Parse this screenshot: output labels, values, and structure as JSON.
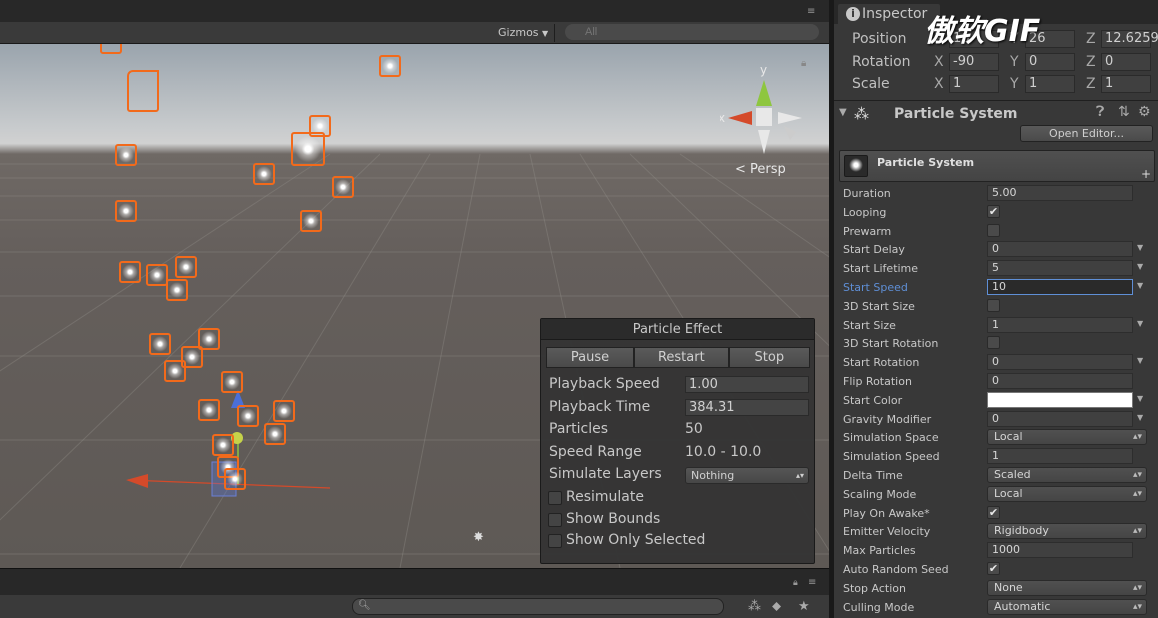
{
  "scene": {
    "gizmos_label": "Gizmos",
    "search_placeholder": "All",
    "persp_label": "< Persp",
    "gizmo_axes": {
      "y": "y",
      "x": "x"
    }
  },
  "particle_effect": {
    "title": "Particle Effect",
    "buttons": [
      "Pause",
      "Restart",
      "Stop"
    ],
    "rows": [
      {
        "label": "Playback Speed",
        "value": "1.00"
      },
      {
        "label": "Playback Time",
        "value": "384.31"
      },
      {
        "label": "Particles",
        "value": "50"
      },
      {
        "label": "Speed Range",
        "value": "10.0 - 10.0"
      },
      {
        "label": "Simulate Layers",
        "value": "Nothing"
      }
    ],
    "checks": [
      "Resimulate",
      "Show Bounds",
      "Show Only Selected"
    ]
  },
  "inspector": {
    "tab_label": "Inspector",
    "watermark": "傲软GIF",
    "transform": [
      {
        "label": "Position",
        "x": "16",
        "y": "26",
        "z": "12.6259"
      },
      {
        "label": "Rotation",
        "x": "-90",
        "y": "0",
        "z": "0"
      },
      {
        "label": "Scale",
        "x": "1",
        "y": "1",
        "z": "1"
      }
    ],
    "axis_labels": [
      "X",
      "Y",
      "Z"
    ],
    "component_title": "Particle System",
    "open_editor": "Open Editor...",
    "module_title": "Particle System",
    "module_plus": "+",
    "properties": [
      {
        "label": "Duration",
        "kind": "field",
        "value": "5.00"
      },
      {
        "label": "Looping",
        "kind": "check",
        "value": "✔"
      },
      {
        "label": "Prewarm",
        "kind": "check",
        "value": ""
      },
      {
        "label": "Start Delay",
        "kind": "field",
        "value": "0",
        "tri": true
      },
      {
        "label": "Start Lifetime",
        "kind": "field",
        "value": "5",
        "tri": true
      },
      {
        "label": "Start Speed",
        "kind": "field",
        "value": "10",
        "tri": true,
        "focus": true
      },
      {
        "label": "3D Start Size",
        "kind": "check",
        "value": ""
      },
      {
        "label": "Start Size",
        "kind": "field",
        "value": "1",
        "tri": true
      },
      {
        "label": "3D Start Rotation",
        "kind": "check",
        "value": ""
      },
      {
        "label": "Start Rotation",
        "kind": "field",
        "value": "0",
        "tri": true
      },
      {
        "label": "Flip Rotation",
        "kind": "field",
        "value": "0"
      },
      {
        "label": "Start Color",
        "kind": "color",
        "value": "",
        "tri": true
      },
      {
        "label": "Gravity Modifier",
        "kind": "field",
        "value": "0",
        "tri": true
      },
      {
        "label": "Simulation Space",
        "kind": "drop",
        "value": "Local"
      },
      {
        "label": "Simulation Speed",
        "kind": "field",
        "value": "1"
      },
      {
        "label": "Delta Time",
        "kind": "drop",
        "value": "Scaled"
      },
      {
        "label": "Scaling Mode",
        "kind": "drop",
        "value": "Local"
      },
      {
        "label": "Play On Awake*",
        "kind": "check",
        "value": "✔"
      },
      {
        "label": "Emitter Velocity",
        "kind": "drop",
        "value": "Rigidbody"
      },
      {
        "label": "Max Particles",
        "kind": "field",
        "value": "1000"
      },
      {
        "label": "Auto Random Seed",
        "kind": "check",
        "value": "✔"
      },
      {
        "label": "Stop Action",
        "kind": "drop",
        "value": "None"
      },
      {
        "label": "Culling Mode",
        "kind": "drop",
        "value": "Automatic"
      }
    ]
  },
  "colors": {
    "selection": "#f26a1b",
    "focus": "#5f8fd6",
    "panel": "#383838"
  }
}
